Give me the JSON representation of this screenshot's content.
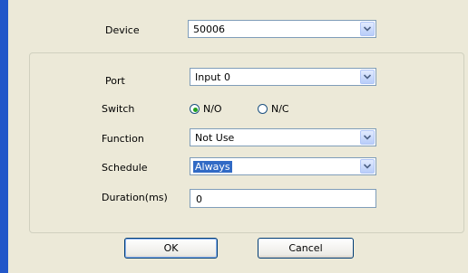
{
  "device": {
    "label": "Device",
    "value": "50006"
  },
  "port": {
    "label": "Port",
    "value": "Input 0"
  },
  "switch": {
    "label": "Switch",
    "options": [
      {
        "label": "N/O",
        "selected": true
      },
      {
        "label": "N/C",
        "selected": false
      }
    ]
  },
  "function": {
    "label": "Function",
    "value": "Not Use"
  },
  "schedule": {
    "label": "Schedule",
    "value": "Always"
  },
  "duration": {
    "label": "Duration(ms)",
    "value": "0"
  },
  "buttons": {
    "ok": "OK",
    "cancel": "Cancel"
  },
  "colors": {
    "accent": "#2257c9",
    "dialog_bg": "#ece9d8",
    "selection": "#316ac5",
    "radio_dot": "#21a121"
  },
  "icons": {
    "dropdown": "chevron-down-icon"
  }
}
